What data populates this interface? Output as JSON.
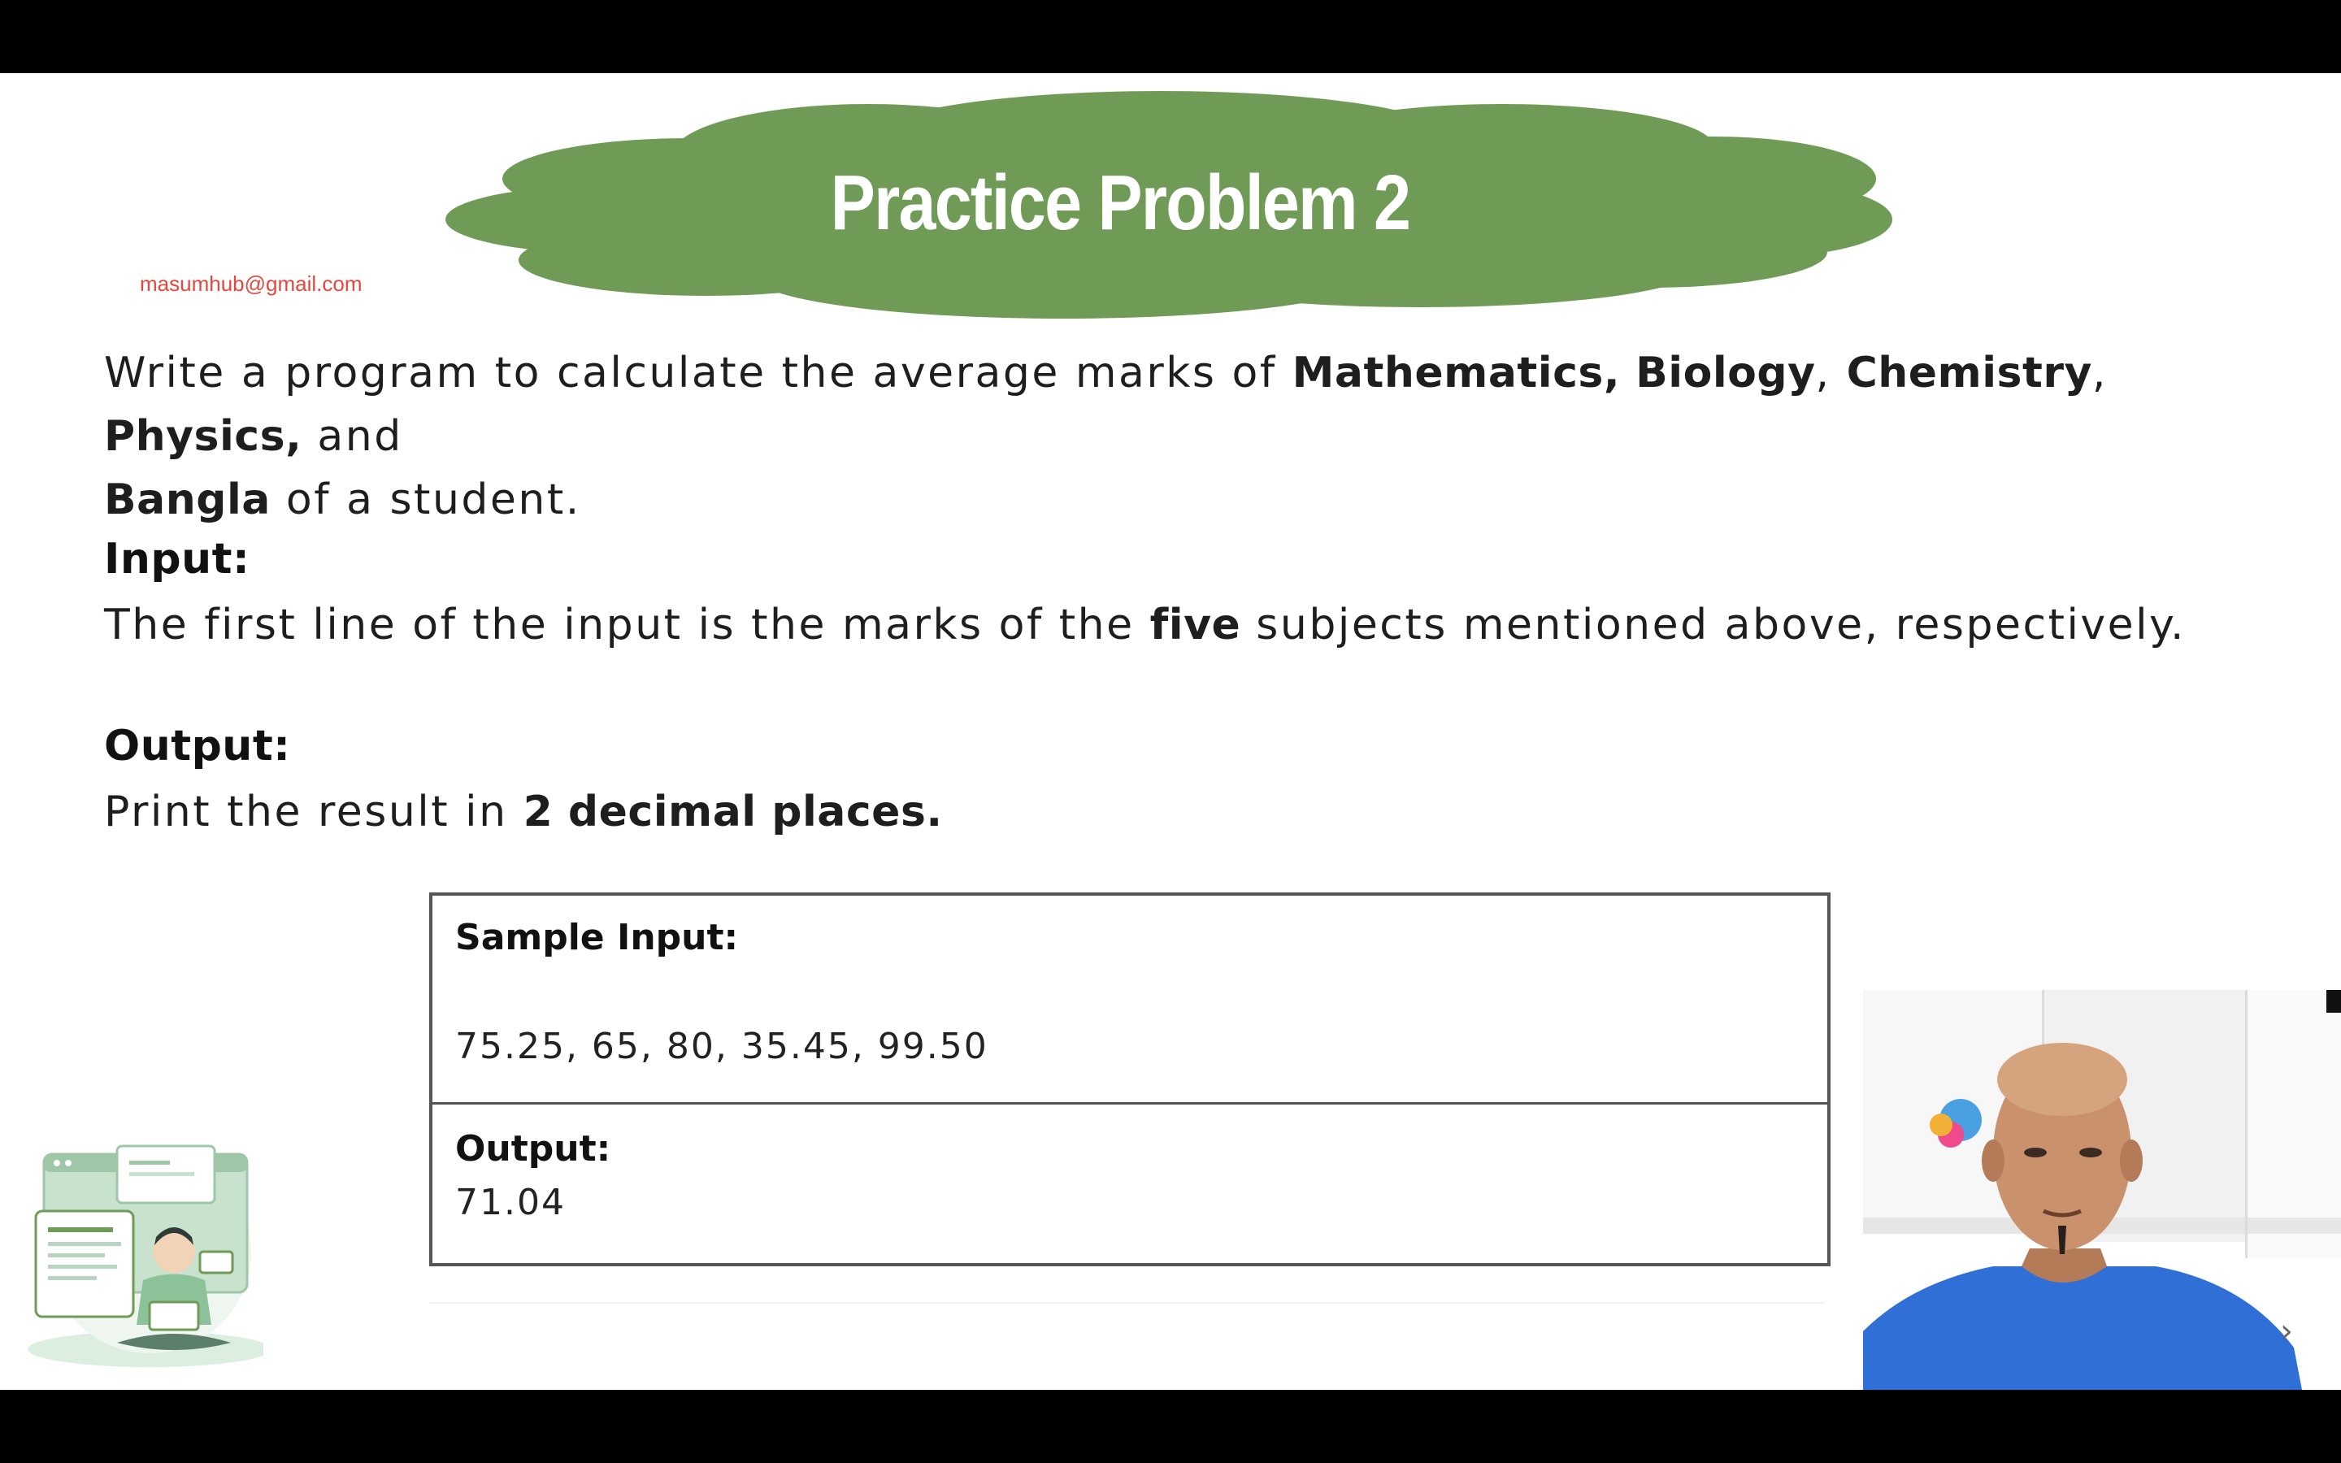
{
  "slide": {
    "title": "Practice Problem 2",
    "email": "masumhub@gmail.com",
    "problem": {
      "intro_1": "Write a program to calculate the average marks of ",
      "subject_math": "Mathematics,",
      "subject_bio": "Biology",
      "comma": ",",
      "subject_chem": "Chemistry",
      "subject_phys": "Physics,",
      "and": " and",
      "subject_bangla": "Bangla",
      "intro_2": " of a student."
    },
    "input_section": {
      "heading": "Input:",
      "text_before": "The first line of the input is the marks of the ",
      "emphasis": "five",
      "text_after": " subjects mentioned above, respectively."
    },
    "output_section": {
      "heading": "Output:",
      "text_before": "Print the result in ",
      "emphasis": "2 decimal places."
    },
    "sample": {
      "input_label": "Sample Input:",
      "input_value": "75.25, 65, 80, 35.45, 99.50",
      "output_label": "Output:",
      "output_value": "71.04"
    },
    "next_icon": "›"
  },
  "colors": {
    "cloud_green": "#6f9b57",
    "email_red": "#e8463c",
    "webcam_shirt": "#2f6fd6",
    "webcam_skin": "#c9926c"
  },
  "icons": [
    "developer-illustration-icon",
    "chevron-right-icon"
  ]
}
